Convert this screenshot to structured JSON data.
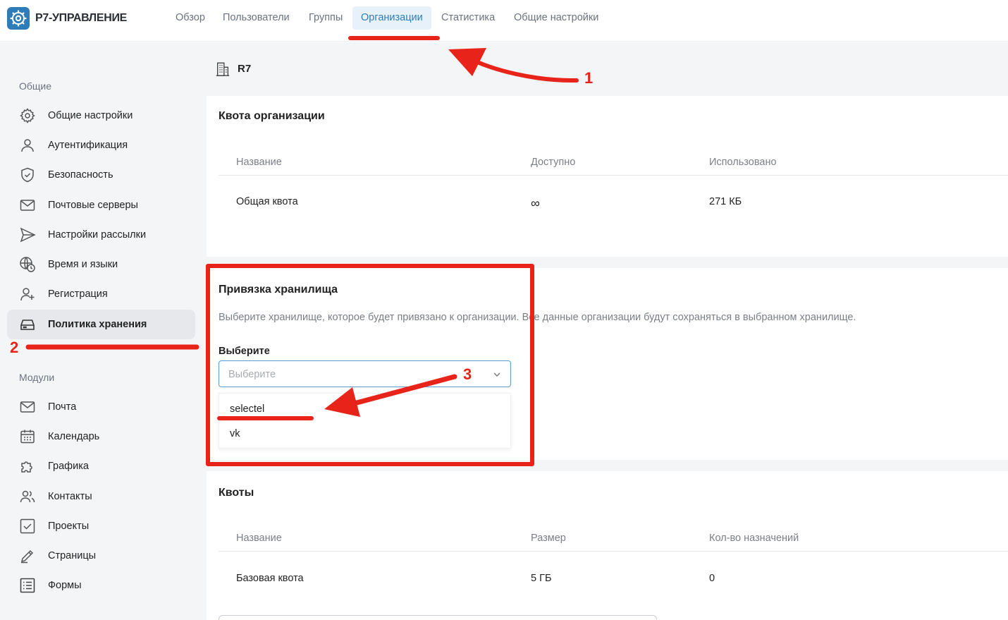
{
  "header": {
    "app_title": "Р7-УПРАВЛЕНИЕ",
    "tabs": [
      {
        "label": "Обзор",
        "active": false
      },
      {
        "label": "Пользователи",
        "active": false
      },
      {
        "label": "Группы",
        "active": false
      },
      {
        "label": "Организации",
        "active": true
      },
      {
        "label": "Статистика",
        "active": false
      },
      {
        "label": "Общие настройки",
        "active": false
      }
    ]
  },
  "sidebar": {
    "section_general": "Общие",
    "general_items": [
      {
        "label": "Общие настройки",
        "icon": "gear-icon"
      },
      {
        "label": "Аутентификация",
        "icon": "user-icon"
      },
      {
        "label": "Безопасность",
        "icon": "shield-icon"
      },
      {
        "label": "Почтовые серверы",
        "icon": "mail-icon"
      },
      {
        "label": "Настройки рассылки",
        "icon": "send-icon"
      },
      {
        "label": "Время и языки",
        "icon": "globe-clock-icon"
      },
      {
        "label": "Регистрация",
        "icon": "user-add-icon"
      },
      {
        "label": "Политика хранения",
        "icon": "storage-icon",
        "active": true
      }
    ],
    "section_modules": "Модули",
    "module_items": [
      {
        "label": "Почта",
        "icon": "mail-icon"
      },
      {
        "label": "Календарь",
        "icon": "calendar-icon"
      },
      {
        "label": "Графика",
        "icon": "puzzle-icon"
      },
      {
        "label": "Контакты",
        "icon": "contacts-icon"
      },
      {
        "label": "Проекты",
        "icon": "checkbox-icon"
      },
      {
        "label": "Страницы",
        "icon": "pen-icon"
      },
      {
        "label": "Формы",
        "icon": "form-icon"
      }
    ]
  },
  "org": {
    "name": "R7",
    "icon": "building-icon"
  },
  "org_quota": {
    "title": "Квота организации",
    "columns": [
      "Название",
      "Доступно",
      "Использовано"
    ],
    "rows": [
      [
        "Общая квота",
        "∞",
        "271 КБ"
      ]
    ]
  },
  "storage_binding": {
    "title": "Привязка хранилища",
    "description": "Выберите хранилище, которое будет привязано к организации. Все данные организации будут сохраняться в выбранном хранилище.",
    "field_label": "Выберите",
    "placeholder": "Выберите",
    "options": [
      "selectel",
      "vk"
    ]
  },
  "quotas": {
    "title": "Квоты",
    "columns": [
      "Название",
      "Размер",
      "Кол-во назначений"
    ],
    "rows": [
      [
        "Базовая квота",
        "5 ГБ",
        "0"
      ]
    ]
  },
  "annotations": {
    "numbers": [
      "1",
      "2",
      "3"
    ],
    "color": "#e8241a"
  },
  "colors": {
    "accent": "#2f7db8",
    "active_tab_bg": "#e7f1fa",
    "sidebar_bg": "#f4f5f7"
  }
}
